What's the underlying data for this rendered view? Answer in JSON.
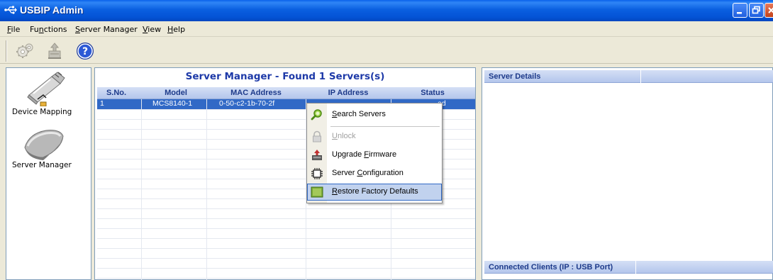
{
  "window": {
    "title": "USBIP Admin"
  },
  "menubar": {
    "items": [
      {
        "label": "File",
        "mnemonic": "F"
      },
      {
        "label": "Functions",
        "mnemonic": "n"
      },
      {
        "label": "Server Manager",
        "mnemonic": "S"
      },
      {
        "label": "View",
        "mnemonic": "V"
      },
      {
        "label": "Help",
        "mnemonic": "H"
      }
    ]
  },
  "toolbar": {
    "icons": [
      "settings-gear-icon",
      "upgrade-firmware-icon",
      "help-icon"
    ]
  },
  "sidebar": {
    "items": [
      {
        "label": "Device Mapping",
        "icon": "usb-device-icon"
      },
      {
        "label": "Server Manager",
        "icon": "server-device-icon"
      }
    ]
  },
  "server_manager": {
    "title": "Server Manager - Found 1 Servers(s)",
    "columns": [
      "S.No.",
      "Model",
      "MAC Address",
      "IP Address",
      "Status"
    ],
    "rows": [
      {
        "sno": "1",
        "model": "MCS8140-1",
        "mac": "0-50-c2-1b-70-2f",
        "ip": "",
        "status": "ed"
      }
    ]
  },
  "context_menu": {
    "items": [
      {
        "label": "Search Servers",
        "icon": "search-icon",
        "enabled": true
      },
      {
        "label": "Unlock",
        "icon": "lock-icon",
        "enabled": false
      },
      {
        "label": "Upgrade Firmware",
        "icon": "upgrade-firmware-icon",
        "enabled": true
      },
      {
        "label": "Server Configuration",
        "icon": "chip-config-icon",
        "enabled": true
      },
      {
        "label": "Restore Factory Defaults",
        "icon": "restore-icon",
        "enabled": true,
        "highlighted": true
      }
    ]
  },
  "details": {
    "server_details_title": "Server Details",
    "connected_clients_title": "Connected Clients (IP : USB Port)"
  },
  "colors": {
    "titlebar": "#0a5fe0",
    "selection": "#3169c6",
    "panel_title": "#1e3aa8",
    "header_text": "#1d3a8a"
  }
}
